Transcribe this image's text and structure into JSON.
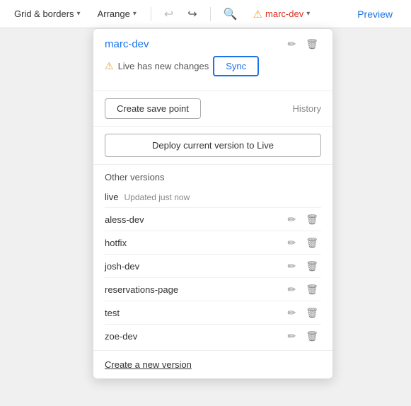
{
  "toolbar": {
    "grid_borders_label": "Grid & borders",
    "arrange_label": "Arrange",
    "undo_label": "Undo",
    "redo_label": "Redo",
    "search_label": "Search",
    "branch_label": "marc-dev",
    "preview_label": "Preview"
  },
  "panel": {
    "current_branch": "marc-dev",
    "warning_text": "Live has new changes",
    "sync_label": "Sync",
    "create_save_label": "Create save point",
    "history_label": "History",
    "deploy_label": "Deploy current version to Live",
    "other_versions_title": "Other versions",
    "versions": [
      {
        "name": "live",
        "tag": "Updated just now",
        "editable": false
      },
      {
        "name": "aless-dev",
        "tag": "",
        "editable": true
      },
      {
        "name": "hotfix",
        "tag": "",
        "editable": true
      },
      {
        "name": "josh-dev",
        "tag": "",
        "editable": true
      },
      {
        "name": "reservations-page",
        "tag": "",
        "editable": true
      },
      {
        "name": "test",
        "tag": "",
        "editable": true
      },
      {
        "name": "zoe-dev",
        "tag": "",
        "editable": true
      }
    ],
    "create_new_label": "Create a new version"
  },
  "icons": {
    "warning": "⚠",
    "edit": "✏",
    "trash": "🗑",
    "chevron_down": "▾",
    "undo": "↩",
    "redo": "↪",
    "search": "🔍"
  }
}
